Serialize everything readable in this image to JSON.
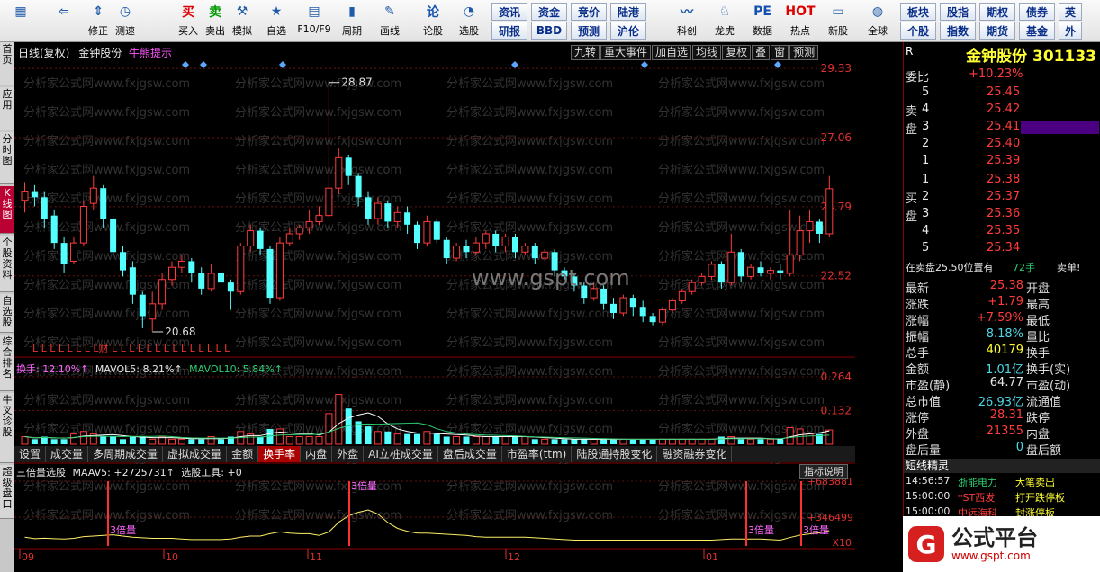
{
  "toolbar": {
    "buttons": [
      {
        "label": "",
        "icon": "grid-icon"
      },
      {
        "label": "",
        "icon": "back-arrow-icon"
      },
      {
        "label": "修正",
        "icon": "arrows-icon"
      },
      {
        "label": "测速",
        "icon": "clock-icon"
      },
      {
        "label": "买入",
        "icon": "buy-icon",
        "glyph": "买"
      },
      {
        "label": "卖出",
        "icon": "sell-icon",
        "glyph": "卖"
      },
      {
        "label": "模拟",
        "icon": "hammer-icon"
      },
      {
        "label": "自选",
        "icon": "star-icon"
      },
      {
        "label": "F10/F9",
        "icon": "f10-icon"
      },
      {
        "label": "周期",
        "icon": "period-icon"
      },
      {
        "label": "画线",
        "icon": "pen-icon"
      },
      {
        "label": "论股",
        "icon": "discuss-icon",
        "glyph": "论"
      },
      {
        "label": "选股",
        "icon": "select-stock-icon"
      },
      {
        "label": "科创",
        "icon": "sci-tech-icon"
      },
      {
        "label": "龙虎",
        "icon": "dragon-tiger-icon"
      },
      {
        "label": "数据",
        "icon": "data-icon",
        "glyph": "PE"
      },
      {
        "label": "热点",
        "icon": "hot-icon",
        "glyph": "HOT"
      },
      {
        "label": "新股",
        "icon": "new-stock-icon"
      },
      {
        "label": "全球",
        "icon": "globe-icon"
      }
    ],
    "small_buttons": [
      [
        "资讯",
        "资金",
        "竞价",
        "陆港"
      ],
      [
        "研报",
        "BBD",
        "预测",
        "沪伦"
      ],
      [
        "板块",
        "股指",
        "期权",
        "债券",
        "英"
      ],
      [
        "个股",
        "指数",
        "期货",
        "基金",
        "外"
      ]
    ]
  },
  "left_tabs": [
    "首页",
    "应用",
    "分时图",
    "K线图",
    "个股资料",
    "自选股",
    "综合排名",
    "牛叉诊股",
    "超级盘口"
  ],
  "chart": {
    "header": {
      "period": "日线(复权)",
      "name": "金钟股份",
      "tip": "牛熊提示"
    },
    "buttons": [
      "九转",
      "重大事件",
      "加自选",
      "均线",
      "复权",
      "叠",
      "窗",
      "预测"
    ],
    "price_axis": [
      "29.33",
      "27.06",
      "24.79",
      "22.52"
    ],
    "high_label": "28.87",
    "low_label": "20.68",
    "watermark": "www.gspt.com",
    "bg_watermark": "分析家公式网www.fxjgsw.com",
    "signal_marks": "L  L  L  L  L  L  L  L财  L  L  L  L  L  L  L  L  L  L  L  L  L  L",
    "volume_header": {
      "label": "换手: 12.10%↑",
      "mavol5": "MAVOL5: 8.21%↑",
      "mavol10": "MAVOL10: 5.84%↑"
    },
    "volume_axis": [
      "0.264",
      "0.132"
    ],
    "indicator_tabs": [
      "设置",
      "成交量",
      "多周期成交量",
      "虚拟成交量",
      "金额",
      "换手率",
      "内盘",
      "外盘",
      "AI立桩成交量",
      "盘后成交量",
      "市盈率(ttm)",
      "陆股通持股变化",
      "融资融券变化"
    ],
    "active_tab": "换手率",
    "indicator_header": {
      "label": "三倍量选股",
      "maav": "MAAV5: +2725731↑",
      "tool": "选股工具: +0"
    },
    "indicator_button": "指标说明",
    "indicator_axis": [
      "+683881",
      "+346499"
    ],
    "indicator_unit": "X10",
    "triple_labels": [
      "3倍量",
      "3倍量",
      "3倍量",
      "3倍量"
    ],
    "months": [
      "09",
      "10",
      "11",
      "12",
      "01"
    ]
  },
  "quote": {
    "code_label": "R",
    "title": "金钟股份 301133",
    "weibi_label": "委比",
    "weibi": "+10.23%",
    "sell_side_label": "卖盘",
    "buy_side_label": "买盘",
    "sell": [
      {
        "level": "5",
        "price": "25.45"
      },
      {
        "level": "4",
        "price": "25.42"
      },
      {
        "level": "3",
        "price": "25.41"
      },
      {
        "level": "2",
        "price": "25.40"
      },
      {
        "level": "1",
        "price": "25.39"
      }
    ],
    "buy": [
      {
        "level": "1",
        "price": "25.38"
      },
      {
        "level": "2",
        "price": "25.37"
      },
      {
        "level": "3",
        "price": "25.36"
      },
      {
        "level": "4",
        "price": "25.35"
      },
      {
        "level": "5",
        "price": "25.34"
      }
    ],
    "pending": "在卖盘25.50位置有",
    "pending_qty": "72手",
    "pending_type": "卖单!",
    "stats": [
      {
        "k": "最新",
        "v": "25.38",
        "k2": "开盘",
        "color": "red"
      },
      {
        "k": "涨跌",
        "v": "+1.79",
        "k2": "最高",
        "color": "red"
      },
      {
        "k": "涨幅",
        "v": "+7.59%",
        "k2": "最低",
        "color": "red"
      },
      {
        "k": "振幅",
        "v": "8.18%",
        "k2": "量比",
        "color": "cyan"
      },
      {
        "k": "总手",
        "v": "40179",
        "k2": "换手",
        "color": "yellow"
      },
      {
        "k": "金额",
        "v": "1.01亿",
        "k2": "换手(实)",
        "color": "cyan"
      },
      {
        "k": "市盈(静)",
        "v": "64.77",
        "k2": "市盈(动)",
        "color": "white"
      },
      {
        "k": "总市值",
        "v": "26.93亿",
        "k2": "流通值",
        "color": "cyan"
      },
      {
        "k": "涨停",
        "v": "28.31",
        "k2": "跌停",
        "color": "red"
      },
      {
        "k": "外盘",
        "v": "21355",
        "k2": "内盘",
        "color": "red"
      },
      {
        "k": "盘后量",
        "v": "0",
        "k2": "盘后额",
        "color": "cyan"
      }
    ],
    "elves_title": "短线精灵",
    "elves": [
      {
        "time": "14:56:57",
        "name": "浙能电力",
        "event": "大笔卖出",
        "color": "green"
      },
      {
        "time": "15:00:00",
        "name": "*ST西发",
        "event": "打开跌停板",
        "color": "red"
      },
      {
        "time": "15:00:00",
        "name": "中远海科",
        "event": "封涨停板",
        "color": "red"
      }
    ]
  },
  "badge": {
    "logo_glyph": "G",
    "title": "公式平台",
    "url": "www.gspt.com"
  },
  "chart_data": {
    "type": "candlestick",
    "title": "",
    "price_range": [
      20.0,
      29.6
    ],
    "candles": [
      [
        25.0,
        25.3,
        25.6,
        24.6
      ],
      [
        25.3,
        25.1,
        25.5,
        24.8
      ],
      [
        25.1,
        24.4,
        25.3,
        24.1
      ],
      [
        24.5,
        23.6,
        24.7,
        23.4
      ],
      [
        23.6,
        22.9,
        23.8,
        22.6
      ],
      [
        23.0,
        23.6,
        23.8,
        22.9
      ],
      [
        23.6,
        24.8,
        25.0,
        23.5
      ],
      [
        24.9,
        25.4,
        25.8,
        24.7
      ],
      [
        25.4,
        24.4,
        25.5,
        24.1
      ],
      [
        24.4,
        23.3,
        24.5,
        23.1
      ],
      [
        23.3,
        22.7,
        23.5,
        22.5
      ],
      [
        22.8,
        21.9,
        23.0,
        21.6
      ],
      [
        21.9,
        21.2,
        22.0,
        20.8
      ],
      [
        21.1,
        21.6,
        22.0,
        20.7
      ],
      [
        21.6,
        22.4,
        22.6,
        21.4
      ],
      [
        22.4,
        22.8,
        23.0,
        22.2
      ],
      [
        22.8,
        23.0,
        23.2,
        22.6
      ],
      [
        23.0,
        22.6,
        23.1,
        22.3
      ],
      [
        22.6,
        22.1,
        22.8,
        21.9
      ],
      [
        22.1,
        22.6,
        22.9,
        22.0
      ],
      [
        22.6,
        22.3,
        22.8,
        22.1
      ],
      [
        22.3,
        22.0,
        22.4,
        21.4
      ],
      [
        22.0,
        23.5,
        23.6,
        21.9
      ],
      [
        23.5,
        24.0,
        24.2,
        23.3
      ],
      [
        24.0,
        23.4,
        24.1,
        23.2
      ],
      [
        23.4,
        21.8,
        23.5,
        21.6
      ],
      [
        21.8,
        23.6,
        23.8,
        21.7
      ],
      [
        23.6,
        23.9,
        24.1,
        23.5
      ],
      [
        23.9,
        24.1,
        24.2,
        23.7
      ],
      [
        24.1,
        24.3,
        24.7,
        23.9
      ],
      [
        24.3,
        24.5,
        24.8,
        24.2
      ],
      [
        24.5,
        25.4,
        28.87,
        24.4
      ],
      [
        25.4,
        26.4,
        26.7,
        25.2
      ],
      [
        26.4,
        25.8,
        26.5,
        25.5
      ],
      [
        25.8,
        25.1,
        25.9,
        24.8
      ],
      [
        25.1,
        24.4,
        25.3,
        24.2
      ],
      [
        24.4,
        24.9,
        25.1,
        24.2
      ],
      [
        24.9,
        24.3,
        25.0,
        24.1
      ],
      [
        24.3,
        24.6,
        24.8,
        24.1
      ],
      [
        24.6,
        24.2,
        24.8,
        23.9
      ],
      [
        24.2,
        23.6,
        24.3,
        23.4
      ],
      [
        23.6,
        24.3,
        24.5,
        23.5
      ],
      [
        24.3,
        23.7,
        24.4,
        23.6
      ],
      [
        23.7,
        23.1,
        23.8,
        22.9
      ],
      [
        23.1,
        23.5,
        23.6,
        23.0
      ],
      [
        23.5,
        23.3,
        23.7,
        23.1
      ],
      [
        23.3,
        23.6,
        23.8,
        23.2
      ],
      [
        23.6,
        23.9,
        24.0,
        23.4
      ],
      [
        23.9,
        23.5,
        24.0,
        23.3
      ],
      [
        23.5,
        23.8,
        23.9,
        23.3
      ],
      [
        23.8,
        23.3,
        23.9,
        23.1
      ],
      [
        23.3,
        23.5,
        23.6,
        23.2
      ],
      [
        23.5,
        23.1,
        23.6,
        22.9
      ],
      [
        23.1,
        23.3,
        23.4,
        23.0
      ],
      [
        23.3,
        22.7,
        23.4,
        22.5
      ],
      [
        22.7,
        22.5,
        22.8,
        22.4
      ],
      [
        22.5,
        22.2,
        22.6,
        22.0
      ],
      [
        22.2,
        21.8,
        22.3,
        21.6
      ],
      [
        21.8,
        22.1,
        22.3,
        21.7
      ],
      [
        22.1,
        21.6,
        22.2,
        21.4
      ],
      [
        21.6,
        21.3,
        21.8,
        21.1
      ],
      [
        21.3,
        21.8,
        21.9,
        21.2
      ],
      [
        21.8,
        21.5,
        21.9,
        21.2
      ],
      [
        21.5,
        21.2,
        21.7,
        21.0
      ],
      [
        21.2,
        21.0,
        21.3,
        20.9
      ],
      [
        21.0,
        21.4,
        21.5,
        20.9
      ],
      [
        21.4,
        21.7,
        21.8,
        21.3
      ],
      [
        21.7,
        22.0,
        22.1,
        21.6
      ],
      [
        22.0,
        22.3,
        22.4,
        21.9
      ],
      [
        22.3,
        22.5,
        22.6,
        22.2
      ],
      [
        22.5,
        22.9,
        23.0,
        22.4
      ],
      [
        22.9,
        22.3,
        23.0,
        22.1
      ],
      [
        22.3,
        23.3,
        23.9,
        22.2
      ],
      [
        23.3,
        22.5,
        23.4,
        22.3
      ],
      [
        22.5,
        22.8,
        22.9,
        22.4
      ],
      [
        22.8,
        22.6,
        23.0,
        22.5
      ],
      [
        22.6,
        22.7,
        22.8,
        22.4
      ],
      [
        22.7,
        22.6,
        22.9,
        22.4
      ],
      [
        22.6,
        23.2,
        24.7,
        22.5
      ],
      [
        23.2,
        24.0,
        24.5,
        23.0
      ],
      [
        24.0,
        24.3,
        24.7,
        23.6
      ],
      [
        24.3,
        23.9,
        24.4,
        23.6
      ],
      [
        23.9,
        25.38,
        25.8,
        23.8
      ]
    ],
    "turnover": [
      0.03,
      0.02,
      0.03,
      0.02,
      0.02,
      0.04,
      0.05,
      0.04,
      0.03,
      0.03,
      0.02,
      0.03,
      0.03,
      0.02,
      0.03,
      0.02,
      0.02,
      0.02,
      0.02,
      0.03,
      0.02,
      0.03,
      0.05,
      0.04,
      0.03,
      0.06,
      0.06,
      0.03,
      0.03,
      0.03,
      0.03,
      0.12,
      0.195,
      0.14,
      0.09,
      0.07,
      0.05,
      0.05,
      0.04,
      0.04,
      0.04,
      0.05,
      0.04,
      0.03,
      0.03,
      0.03,
      0.03,
      0.03,
      0.03,
      0.03,
      0.03,
      0.03,
      0.02,
      0.02,
      0.02,
      0.02,
      0.02,
      0.02,
      0.02,
      0.02,
      0.02,
      0.02,
      0.02,
      0.02,
      0.02,
      0.02,
      0.02,
      0.02,
      0.02,
      0.02,
      0.02,
      0.03,
      0.03,
      0.02,
      0.02,
      0.02,
      0.02,
      0.02,
      0.065,
      0.06,
      0.04,
      0.04,
      0.056
    ],
    "turnover_range": [
      0,
      0.264
    ]
  }
}
